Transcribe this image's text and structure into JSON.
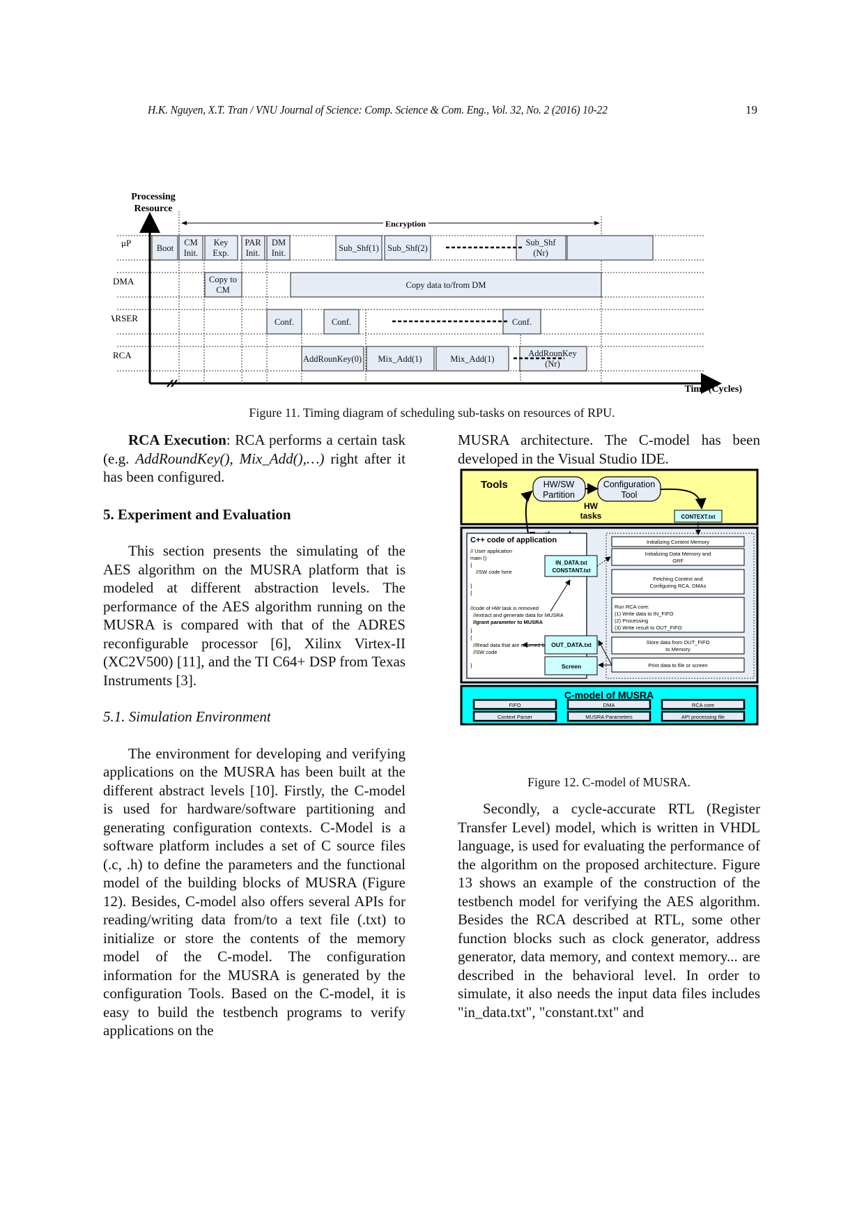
{
  "header": {
    "running_head": "H.K. Nguyen, X.T. Tran / VNU Journal of Science: Comp. Science & Com. Eng., Vol. 32, No. 2 (2016) 10-22",
    "page_number": "19"
  },
  "figure11": {
    "caption": "Figure 11. Timing diagram of scheduling sub-tasks on resources of RPU.",
    "y_axis_label_line1": "Processing",
    "y_axis_label_line2": "Resource",
    "x_axis_label": "Time (Cycles)",
    "span_label": "Encryption",
    "rows": [
      "μP",
      "DMA",
      "PARSER",
      "RCA"
    ],
    "tasks": {
      "up": [
        {
          "l1": "Boot",
          "l2": ""
        },
        {
          "l1": "CM",
          "l2": "Init."
        },
        {
          "l1": "Key",
          "l2": "Exp."
        },
        {
          "l1": "PAR",
          "l2": "Init."
        },
        {
          "l1": "DM",
          "l2": "Init."
        },
        {
          "l1": "Sub_Shf(1)",
          "l2": ""
        },
        {
          "l1": "Sub_Shf(2)",
          "l2": ""
        },
        {
          "l1": "Sub_Shf",
          "l2": "(Nr)"
        },
        {
          "l1": "",
          "l2": ""
        }
      ],
      "dma": [
        {
          "l1": "Copy to",
          "l2": "CM"
        },
        {
          "l1": "Copy data to/from DM",
          "l2": ""
        }
      ],
      "parser": [
        {
          "l1": "Conf.",
          "l2": ""
        },
        {
          "l1": "Conf.",
          "l2": ""
        },
        {
          "l1": "Conf.",
          "l2": ""
        }
      ],
      "rca": [
        {
          "l1": "AddRounKey(0)",
          "l2": ""
        },
        {
          "l1": "Mix_Add(1)",
          "l2": ""
        },
        {
          "l1": "Mix_Add(1)",
          "l2": ""
        },
        {
          "l1": "AddRounKey",
          "l2": "(Nr)"
        }
      ]
    }
  },
  "figure12": {
    "caption": "Figure 12. C-model of MUSRA.",
    "tools": {
      "title": "Tools",
      "hwsw_l1": "HW/SW",
      "hwsw_l2": "Partition",
      "hw_tasks_l1": "HW",
      "hw_tasks_l2": "tasks",
      "config_l1": "Configuration",
      "config_l2": "Tool",
      "context_file": "CONTEXT.txt"
    },
    "testbench": {
      "title": "Testbench",
      "code_title": "C++ code of application",
      "code_lines": [
        "// User application",
        "main ()",
        "{",
        "    //SW code here",
        "",
        "}",
        "{",
        "",
        " //code of HW task is removed",
        "   //extract and generate data for MUSRA",
        "   //grant parameter to MUSRA",
        "",
        "}",
        "{",
        "  //Read data that are returned by HW",
        "  //SW code",
        "",
        "}"
      ],
      "in_files_l1": "IN_DATA.txt",
      "in_files_l2": "CONSTANT.txt",
      "out_file": "OUT_DATA.txt",
      "screen": "Screen",
      "steps": [
        {
          "l1": "Initializing Context Memory",
          "l2": "",
          "l3": "",
          "l4": ""
        },
        {
          "l1": "Initializing Data Memory and",
          "l2": "GRF",
          "l3": "",
          "l4": ""
        },
        {
          "l1": "Fetching Context and",
          "l2": "Configuring RCA, DMAs",
          "l3": "",
          "l4": ""
        },
        {
          "l1": "Run RCA core:",
          "l2": "(1) Write data to IN_FIFO",
          "l3": "(2) Processing",
          "l4": "(3) Write result to OUT_FIFO"
        },
        {
          "l1": "Store data from OUT_FIFO",
          "l2": "to Memory",
          "l3": "",
          "l4": ""
        },
        {
          "l1": "Print data to file or screen",
          "l2": "",
          "l3": "",
          "l4": ""
        }
      ]
    },
    "cmodel": {
      "title": "C-model of MUSRA",
      "blocks": [
        "FIFO",
        "DMA",
        "RCA core",
        "Context Parser",
        "MUSRA Parameters",
        "API processing file"
      ]
    }
  },
  "left_column": {
    "rca_exec_bold": "RCA Execution",
    "rca_exec_rest1": ": RCA performs a certain task (e.g. ",
    "rca_exec_italic": "AddRoundKey(), Mix_Add(),…)",
    "rca_exec_rest2": " right after it has been configured.",
    "section_heading": "5. Experiment and Evaluation",
    "para1": "This section presents the simulating of the AES algorithm on the MUSRA platform that is modeled at different abstraction levels. The performance of the AES algorithm running on the MUSRA is compared with that of the ADRES reconfigurable processor [6], Xilinx Virtex-II (XC2V500) [11], and the TI C64+ DSP from Texas Instruments [3].",
    "subsection_heading": "5.1. Simulation Environment",
    "para2": "The environment for developing and verifying applications on the MUSRA has been built at the different abstract levels [10]. Firstly, the C-model is used for hardware/software partitioning and generating configuration contexts. C-Model is a software platform includes a set of C source files (.c, .h) to define the parameters and the functional model of the building blocks of MUSRA (Figure 12). Besides, C-model also offers several APIs for reading/writing data from/to a text file (.txt) to initialize or store the contents of the memory model of the C-model. The configuration information for the MUSRA is generated by the configuration Tools. Based on the C-model, it is easy to build the testbench programs to verify applications on the"
  },
  "right_column": {
    "para_cont": "MUSRA architecture. The C-model has been developed in the Visual Studio IDE.",
    "para3": "Secondly, a cycle-accurate RTL (Register Transfer Level) model, which is written in VHDL language, is used for evaluating the performance of the algorithm on the proposed architecture. Figure 13 shows an example of the construction of the testbench model for verifying the AES algorithm. Besides the RCA described at RTL, some other function blocks such as clock generator, address generator, data memory, and context memory... are described in the behavioral level. In order to simulate, it also needs the input data files includes \"in_data.txt\", \"constant.txt\" and"
  },
  "colors": {
    "task_fill": "#e6ecf6",
    "tools_fill": "#ffff99",
    "testbench_fill": "#e8eef6",
    "file_fill": "#ccffff",
    "cmodel_fill": "#00ffff"
  }
}
